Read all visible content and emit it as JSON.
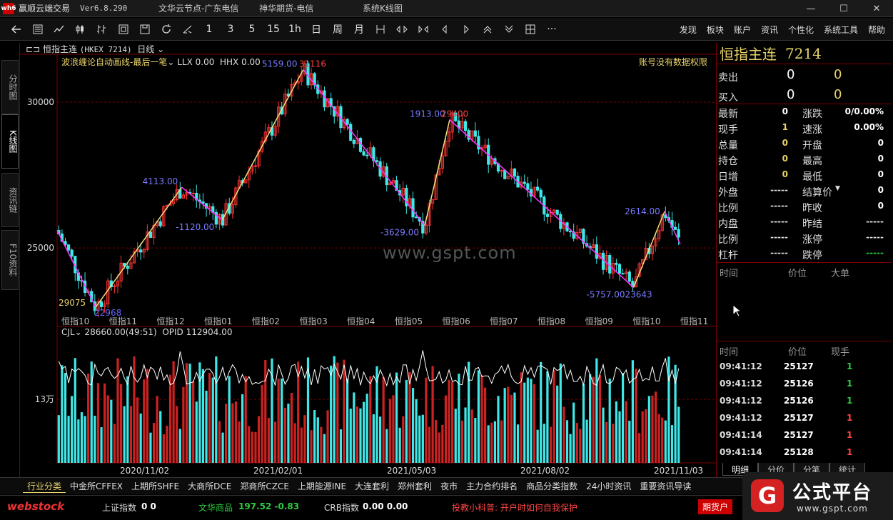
{
  "app": {
    "title": "赢顺云端交易",
    "version": "Ver6.8.290",
    "server1": "文华云节点-广东电信",
    "server2": "神华期货-电信",
    "server3": "系统K线图",
    "logo_text": "wh6"
  },
  "window": {
    "min": "—",
    "max": "☐",
    "close": "✕"
  },
  "toolbar": {
    "periods": [
      "1",
      "3",
      "5",
      "15",
      "1h",
      "日",
      "周",
      "月"
    ],
    "more": "···",
    "menu": [
      "发现",
      "板块",
      "账户",
      "资讯",
      "个性化",
      "系统工具",
      "帮助"
    ]
  },
  "left_tabs": [
    "分时图",
    "K线图",
    "资讯链",
    "F10资料"
  ],
  "chart": {
    "name": "恒指主连",
    "code": "(HKEX 7214)",
    "period": "日线",
    "indicator_name": "波浪缠论自动画线-最后一笔",
    "llx": "LLX 0.00",
    "hhx": "HHX 0.00",
    "no_permission": "账号没有数据权限",
    "watermark": "www.gspt.com",
    "y_labels": [
      {
        "v": 30000,
        "t": "30000"
      },
      {
        "v": 25000,
        "t": "25000"
      }
    ],
    "vol_y_label": "13万",
    "month_labels": [
      "恒指10",
      "恒指11",
      "恒指12",
      "恒指01",
      "恒指02",
      "恒指03",
      "恒指04",
      "恒指05",
      "恒指06",
      "恒指07",
      "恒指08",
      "恒指09",
      "恒指10",
      "恒指11"
    ],
    "date_labels": [
      "2020/11/02",
      "2021/02/01",
      "2021/05/03",
      "2021/08/02",
      "2021/11/03"
    ],
    "vol_head": "CJL",
    "vol_values": "28660.00(49:51)",
    "opid": "OPID 112904.00",
    "annotations": [
      {
        "text": "22968",
        "color": "#6666ff"
      },
      {
        "text": "4113.00",
        "color": "#7a7aff"
      },
      {
        "text": "-1120.00",
        "color": "#7a7aff"
      },
      {
        "text": "5159.00",
        "color": "#7a7aff"
      },
      {
        "text": "31116",
        "color": "#ff4444"
      },
      {
        "text": "1913.00",
        "color": "#7a7aff"
      },
      {
        "text": "29400",
        "color": "#ff4444"
      },
      {
        "text": "-3629.00",
        "color": "#7a7aff"
      },
      {
        "text": "2614.00",
        "color": "#7a7aff"
      },
      {
        "text": "-5757.00",
        "color": "#7a7aff"
      },
      {
        "text": "23643",
        "color": "#7a7aff"
      },
      {
        "text": "29075",
        "color": "#e8d36a"
      }
    ]
  },
  "chart_data": {
    "type": "candlestick",
    "y_range": [
      22600,
      31300
    ],
    "zigzag_pivots": [
      {
        "label": "start",
        "y": 25600
      },
      {
        "label": "low",
        "y": 22968
      },
      {
        "label": "high",
        "y": 27081
      },
      {
        "label": "low",
        "y": 25961
      },
      {
        "label": "high",
        "y": 31116
      },
      {
        "label": "low",
        "y": 25771
      },
      {
        "label": "high",
        "y": 29400
      },
      {
        "label": "low",
        "y": 23643
      },
      {
        "label": "high",
        "y": 26257
      },
      {
        "label": "end",
        "y": 25127
      }
    ]
  },
  "quote": {
    "title": "恒指主连",
    "code": "7214",
    "sell_label": "卖出",
    "sell_v1": "0",
    "sell_v2": "0",
    "buy_label": "买入",
    "buy_v1": "0",
    "buy_v2": "0",
    "rows": [
      {
        "k1": "最新",
        "v1": "0",
        "c1": "#fff",
        "k2": "涨跌",
        "v2": "0/0.00%",
        "c2": "#fff"
      },
      {
        "k1": "现手",
        "v1": "1",
        "c1": "#e8d36a",
        "k2": "速涨",
        "v2": "0.00%",
        "c2": "#fff"
      },
      {
        "k1": "总量",
        "v1": "0",
        "c1": "#e8d36a",
        "k2": "开盘",
        "v2": "0",
        "c2": "#fff"
      },
      {
        "k1": "持仓",
        "v1": "0",
        "c1": "#e8d36a",
        "k2": "最高",
        "v2": "0",
        "c2": "#fff"
      },
      {
        "k1": "日增",
        "v1": "0",
        "c1": "#e8d36a",
        "k2": "最低",
        "v2": "0",
        "c2": "#fff"
      },
      {
        "k1": "外盘",
        "v1": "-----",
        "c1": "#ddd",
        "k2": "结算价",
        "v2": "0",
        "c2": "#fff"
      },
      {
        "k1": "比例",
        "v1": "-----",
        "c1": "#ddd",
        "k2": "昨收",
        "v2": "0",
        "c2": "#fff"
      },
      {
        "k1": "内盘",
        "v1": "-----",
        "c1": "#ddd",
        "k2": "昨结",
        "v2": "-----",
        "c2": "#ddd"
      },
      {
        "k1": "比例",
        "v1": "-----",
        "c1": "#ddd",
        "k2": "涨停",
        "v2": "-----",
        "c2": "#ddd"
      },
      {
        "k1": "杠杆",
        "v1": "-----",
        "c1": "#ddd",
        "k2": "跌停",
        "v2": "-----",
        "c2": "#2ecc40"
      }
    ],
    "bigorder_head": [
      "时间",
      "价位",
      "大单"
    ],
    "ticks_head": [
      "时间",
      "价位",
      "现手"
    ],
    "ticks": [
      {
        "t": "09:41:12",
        "p": "25127",
        "v": "1",
        "c": "#2ecc40"
      },
      {
        "t": "09:41:12",
        "p": "25126",
        "v": "1",
        "c": "#2ecc40"
      },
      {
        "t": "09:41:12",
        "p": "25126",
        "v": "1",
        "c": "#2ecc40"
      },
      {
        "t": "09:41:12",
        "p": "25127",
        "v": "1",
        "c": "#ff4444"
      },
      {
        "t": "09:41:14",
        "p": "25127",
        "v": "1",
        "c": "#ff4444"
      },
      {
        "t": "09:41:14",
        "p": "25128",
        "v": "1",
        "c": "#ff4444"
      }
    ],
    "tabs": [
      "明细",
      "分价",
      "分笔",
      "统计"
    ]
  },
  "bottom_tabs": [
    "行业分类",
    "中金所CFFEX",
    "上期所SHFE",
    "大商所DCE",
    "郑商所CZCE",
    "上期能源INE",
    "大连套利",
    "郑州套利",
    "夜市",
    "主力合约排名",
    "商品分类指数",
    "24小时资讯",
    "重要资讯导读"
  ],
  "status": {
    "logo": "webstock",
    "sh_label": "上证指数",
    "sh_v": "0 0",
    "wh_label": "文华商品",
    "wh_v": "197.52 -0.83",
    "crb_label": "CRB指数",
    "crb_v": "0.00 0.00",
    "tip": "投教小科普: 开户时如何自我保护",
    "account": "期货户"
  },
  "brand": {
    "mark": "G",
    "name": "公式平台",
    "url": "www.gspt.com"
  }
}
